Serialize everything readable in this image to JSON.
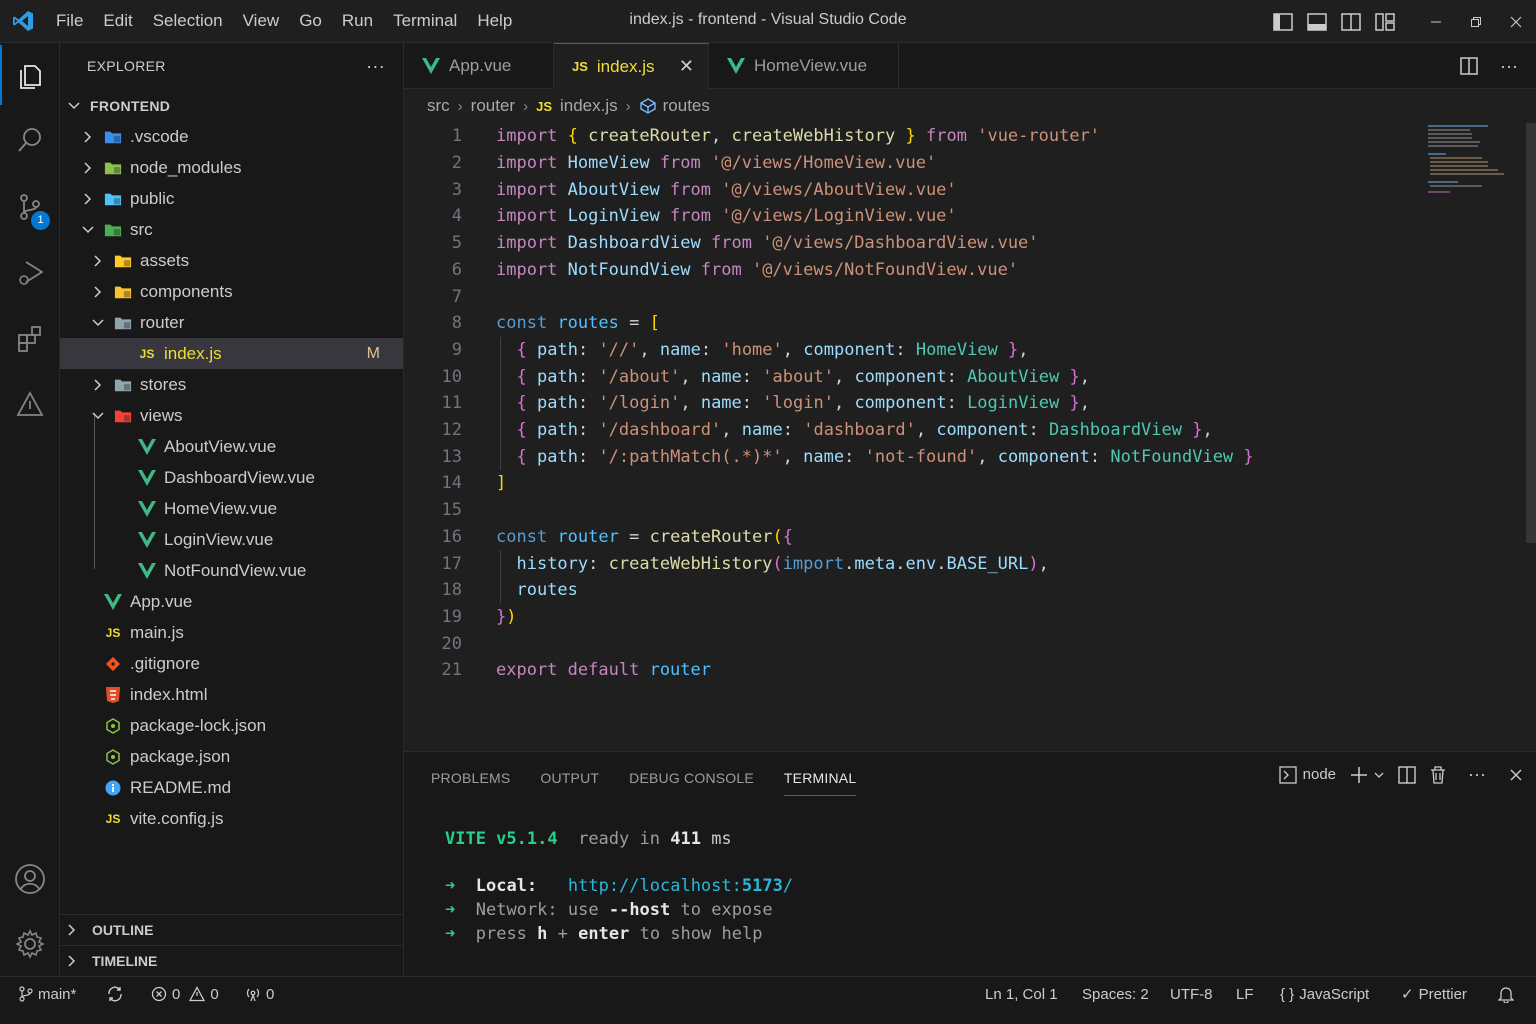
{
  "titlebar": {
    "menu": [
      "File",
      "Edit",
      "Selection",
      "View",
      "Go",
      "Run",
      "Terminal",
      "Help"
    ],
    "window_title": "index.js - frontend - Visual Studio Code"
  },
  "activitybar": {
    "items": [
      "files-icon",
      "search-icon",
      "source-control-icon",
      "run-debug-icon",
      "extensions-icon",
      "warning-icon"
    ],
    "scm_badge": "1",
    "bottom": [
      "account-icon",
      "settings-gear-icon"
    ]
  },
  "sidebar": {
    "title": "EXPLORER",
    "more": "···",
    "root": "FRONTEND",
    "tree": [
      {
        "label": ".vscode",
        "modified": ""
      },
      {
        "label": "node_modules",
        "modified": ""
      },
      {
        "label": "public",
        "modified": ""
      },
      {
        "label": "src",
        "modified": ""
      },
      {
        "label": "assets",
        "modified": ""
      },
      {
        "label": "components",
        "modified": ""
      },
      {
        "label": "router",
        "modified": ""
      },
      {
        "label": "index.js",
        "modified": "M"
      },
      {
        "label": "stores",
        "modified": ""
      },
      {
        "label": "views",
        "modified": ""
      },
      {
        "label": "AboutView.vue",
        "modified": ""
      },
      {
        "label": "DashboardView.vue",
        "modified": ""
      },
      {
        "label": "HomeView.vue",
        "modified": ""
      },
      {
        "label": "LoginView.vue",
        "modified": ""
      },
      {
        "label": "NotFoundView.vue",
        "modified": ""
      },
      {
        "label": "App.vue",
        "modified": ""
      },
      {
        "label": "main.js",
        "modified": ""
      },
      {
        "label": ".gitignore",
        "modified": ""
      },
      {
        "label": "index.html",
        "modified": ""
      },
      {
        "label": "package-lock.json",
        "modified": ""
      },
      {
        "label": "package.json",
        "modified": ""
      },
      {
        "label": "README.md",
        "modified": ""
      },
      {
        "label": "vite.config.js",
        "modified": ""
      }
    ],
    "outline": "OUTLINE",
    "timeline": "TIMELINE"
  },
  "tabs": [
    {
      "label": "App.vue",
      "icon_text": "V"
    },
    {
      "label": "index.js",
      "icon_text": "JS",
      "close": "✕"
    },
    {
      "label": "HomeView.vue",
      "icon_text": "V"
    }
  ],
  "breadcrumbs": {
    "items": [
      "src",
      "router",
      "index.js",
      "routes"
    ],
    "js_icon": "JS"
  },
  "editor": {
    "line_numbers": [
      "1",
      "2",
      "3",
      "4",
      "5",
      "6",
      "7",
      "8",
      "9",
      "10",
      "11",
      "12",
      "13",
      "14",
      "15",
      "16",
      "17",
      "18",
      "19",
      "20",
      "21"
    ],
    "lines": [
      "import { createRouter, createWebHistory } from 'vue-router'",
      "import HomeView from '@/views/HomeView.vue'",
      "import AboutView from '@/views/AboutView.vue'",
      "import LoginView from '@/views/LoginView.vue'",
      "import DashboardView from '@/views/DashboardView.vue'",
      "import NotFoundView from '@/views/NotFoundView.vue'",
      "",
      "const routes = [",
      "  { path: '//', name: 'home', component: HomeView },",
      "  { path: '/about', name: 'about', component: AboutView },",
      "  { path: '/login', name: 'login', component: LoginView },",
      "  { path: '/dashboard', name: 'dashboard', component: DashboardView },",
      "  { path: '/:pathMatch(.*)*', name: 'not-found', component: NotFoundView }",
      "]",
      "",
      "const router = createRouter({",
      "  history: createWebHistory(import.meta.env.BASE_URL),",
      "  routes",
      "})",
      "",
      "export default router"
    ]
  },
  "panel": {
    "tabs": [
      "PROBLEMS",
      "OUTPUT",
      "DEBUG CONSOLE",
      "TERMINAL"
    ],
    "active_tab": "TERMINAL",
    "terminal_name": "node",
    "vite_name": "VITE v5.1.4",
    "vite_ready": "ready in",
    "vite_ms": "411",
    "vite_ms_unit": "ms",
    "arrow": "➜",
    "local_label": "Local:",
    "local_url_prefix": "http://localhost:",
    "local_port": "5173",
    "local_url_suffix": "/",
    "network_label": "Network:",
    "network_use": "use",
    "network_flag": "--host",
    "network_rest": "to expose",
    "help_press": "press",
    "help_h": "h",
    "help_plus": "+",
    "help_enter": "enter",
    "help_rest": "to show help"
  },
  "statusbar": {
    "branch": "main*",
    "errors": "0",
    "warnings": "0",
    "ports": "0",
    "position": "Ln 1, Col 1",
    "spaces": "Spaces: 2",
    "encoding": "UTF-8",
    "eol": "LF",
    "language": "JavaScript",
    "formatter": "Prettier"
  },
  "colors": {
    "accent": "#0078d4",
    "vue_green": "#41b883",
    "js_yellow": "#f1dd35",
    "modified": "#e2c08d"
  }
}
